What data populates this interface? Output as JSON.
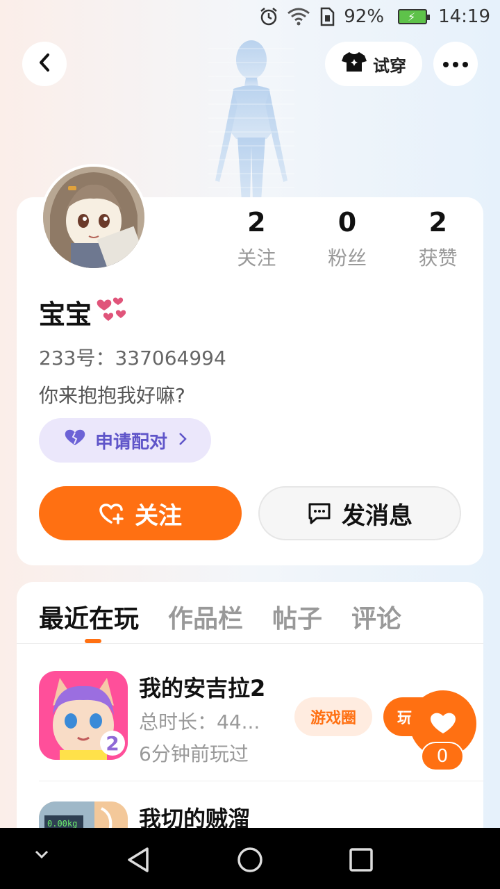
{
  "status_bar": {
    "battery": "92%",
    "time": "14:19",
    "icons": [
      "alarm-icon",
      "wifi-icon",
      "sim-icon",
      "battery-icon"
    ]
  },
  "header": {
    "try_on_label": "试穿",
    "icons": [
      "back-icon",
      "tshirt-icon",
      "more-icon"
    ]
  },
  "profile": {
    "stats": [
      {
        "num": "2",
        "label": "关注"
      },
      {
        "num": "0",
        "label": "粉丝"
      },
      {
        "num": "2",
        "label": "获赞"
      }
    ],
    "nickname": "宝宝",
    "uid": "233号：337064994",
    "bio": "你来抱抱我好嘛?",
    "pair_label": "申请配对",
    "follow_label": "关注",
    "message_label": "发消息"
  },
  "tabs": [
    "最近在玩",
    "作品栏",
    "帖子",
    "评论"
  ],
  "games": [
    {
      "name": "我的安吉拉2",
      "time": "总时长：44...",
      "last": "6分钟前玩过",
      "circle": "游戏圈",
      "play": "玩"
    },
    {
      "name": "我切的贼溜"
    }
  ],
  "float_like": {
    "count": "0"
  },
  "colors": {
    "accent": "#ff7012",
    "pair": "#5f55c9",
    "pair_bg": "#ebe7fb"
  }
}
